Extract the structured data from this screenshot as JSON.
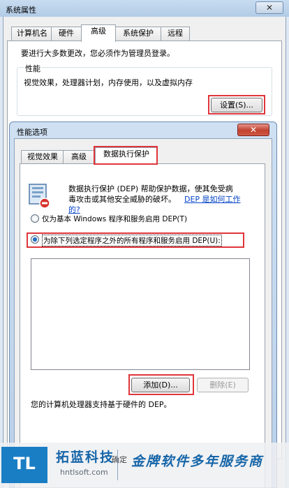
{
  "outer": {
    "title": "系统属性",
    "close_glyph": "✕",
    "tabs": [
      "计算机名",
      "硬件",
      "高级",
      "系统保护",
      "远程"
    ],
    "admin_note": "要进行大多数更改，您必须作为管理员登录。",
    "perf_group_title": "性能",
    "perf_desc": "视觉效果，处理器计划，内存使用，以及虚拟内存",
    "settings_button": "设置(S)..."
  },
  "dialog": {
    "title": "性能选项",
    "close_glyph": "✕",
    "tabs": [
      "视觉效果",
      "高级",
      "数据执行保护"
    ],
    "dep_desc_line1": "数据执行保护 (DEP) 帮助保护数据，使其免受病",
    "dep_desc_line2": "毒攻击或其他安全威胁的破坏。",
    "dep_link_a": "DEP 是如何工作",
    "dep_link_b": "的?",
    "option1": "仅为基本 Windows 程序和服务启用 DEP(T)",
    "option2": "为除下列选定程序之外的所有程序和服务启用 DEP(U):",
    "selected_option": 2,
    "add_button": "添加(D)...",
    "remove_button": "删除(E)",
    "hw_note": "您的计算机处理器支持基于硬件的 DEP。",
    "ok_button": "确定"
  },
  "watermark": {
    "badge": "TL",
    "name": "拓蓝科技",
    "url": "hntlsoft.com",
    "slogan": "金牌软件多年服务商"
  },
  "colors": {
    "highlight": "#e0353b",
    "link": "#0645c8",
    "brand": "#1565a8"
  }
}
